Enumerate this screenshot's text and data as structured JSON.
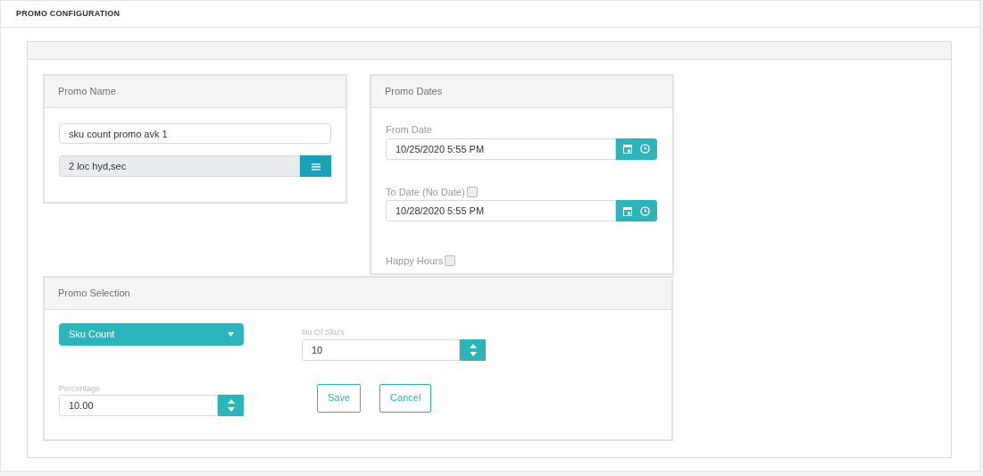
{
  "page_title": "PROMO CONFIGURATION",
  "promo_name": {
    "title": "Promo Name",
    "name_value": "sku count promo avk 1",
    "locations_value": "2 loc hyd,sec"
  },
  "promo_dates": {
    "title": "Promo Dates",
    "from_label": "From Date",
    "from_value": "10/25/2020 5:55 PM",
    "to_label": "To Date (No Date)",
    "no_date_checked": false,
    "to_value": "10/28/2020 5:55 PM",
    "happy_hours_label": "Happy Hours",
    "happy_hours_checked": false
  },
  "promo_selection": {
    "title": "Promo Selection",
    "type_value": "Sku Count",
    "sku_label": "No Of Sku's",
    "sku_value": "10",
    "percentage_label": "Percentage",
    "percentage_value": "10.00",
    "buttons": [
      "Save",
      "Cancel"
    ]
  }
}
